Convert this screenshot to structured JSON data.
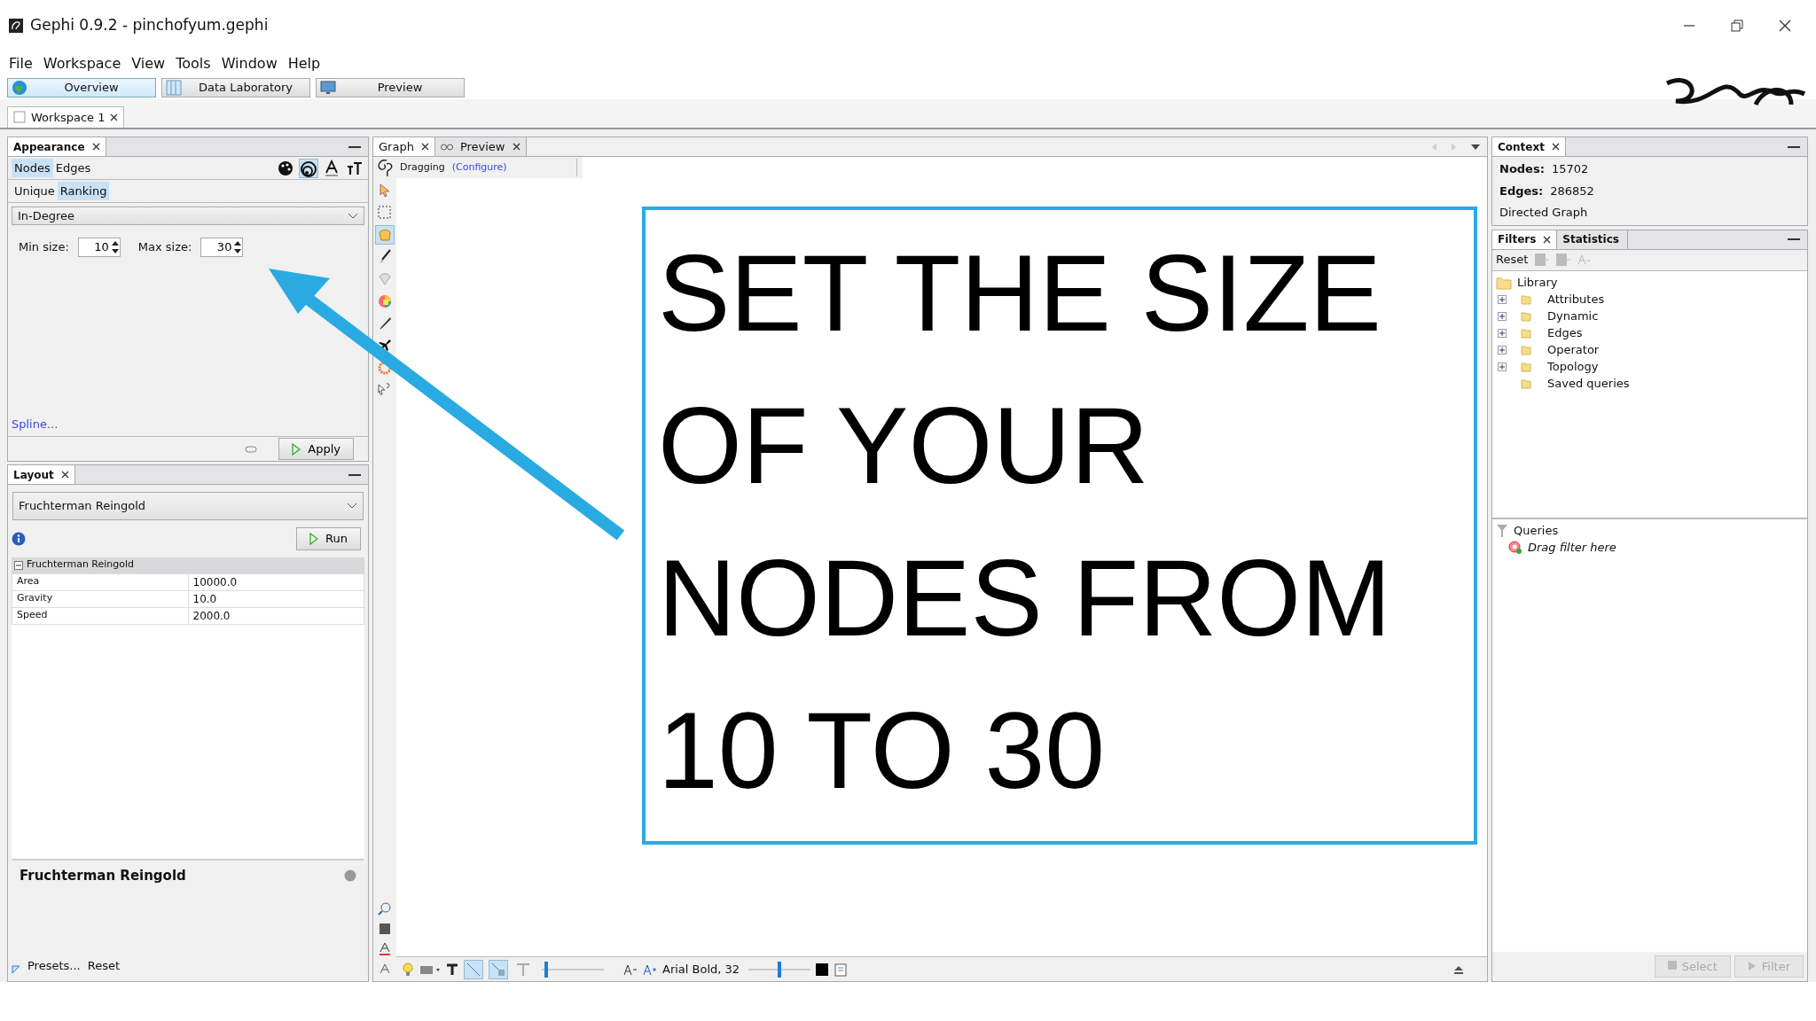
{
  "window": {
    "title": "Gephi 0.9.2 - pinchofyum.gephi"
  },
  "menu": [
    "File",
    "Workspace",
    "View",
    "Tools",
    "Window",
    "Help"
  ],
  "perspectives": [
    {
      "label": "Overview",
      "selected": true
    },
    {
      "label": "Data Laboratory",
      "selected": false
    },
    {
      "label": "Preview",
      "selected": false
    }
  ],
  "workspace_tabs": [
    {
      "label": "Workspace 1",
      "selected": true
    }
  ],
  "appearance": {
    "title": "Appearance",
    "element_tabs": [
      {
        "label": "Nodes",
        "selected": true
      },
      {
        "label": "Edges",
        "selected": false
      }
    ],
    "transform_icons": [
      {
        "kind": "color",
        "selected": false
      },
      {
        "kind": "size",
        "selected": true
      },
      {
        "kind": "label-color",
        "selected": false
      },
      {
        "kind": "label-size",
        "selected": false
      }
    ],
    "mode_tabs": [
      {
        "label": "Unique",
        "selected": false
      },
      {
        "label": "Ranking",
        "selected": true
      }
    ],
    "attribute": "In-Degree",
    "min_label": "Min size:",
    "min_value": "10",
    "max_label": "Max size:",
    "max_value": "30",
    "spline_link": "Spline...",
    "apply_button": "Apply"
  },
  "layout": {
    "title": "Layout",
    "algorithm": "Fruchterman Reingold",
    "run_button": "Run",
    "group": "Fruchterman Reingold",
    "properties": [
      {
        "name": "Area",
        "value": "10000.0"
      },
      {
        "name": "Gravity",
        "value": "10.0"
      },
      {
        "name": "Speed",
        "value": "2000.0"
      }
    ],
    "description_title": "Fruchterman Reingold",
    "presets": "Presets...",
    "reset": "Reset"
  },
  "graph": {
    "tabs": [
      {
        "label": "Graph",
        "selected": true
      },
      {
        "label": "Preview",
        "selected": false
      }
    ],
    "mode": "Dragging",
    "configure": "(Configure)",
    "tools": [
      {
        "kind": "pointer",
        "selected": false
      },
      {
        "kind": "rect",
        "selected": false
      },
      {
        "kind": "hand",
        "selected": true
      },
      {
        "kind": "brush",
        "selected": false
      },
      {
        "kind": "diamond",
        "selected": false
      },
      {
        "kind": "palette",
        "selected": false
      },
      {
        "kind": "pencil",
        "selected": false
      },
      {
        "kind": "plane",
        "selected": false
      },
      {
        "kind": "flower",
        "selected": false
      },
      {
        "kind": "help",
        "selected": false
      }
    ],
    "bottom_toggles": [
      {
        "kind": "edges",
        "selected": true
      },
      {
        "kind": "edge-color",
        "selected": true
      },
      {
        "kind": "label-text",
        "selected": false
      }
    ],
    "edge_scale": {
      "level": 0.05
    },
    "font": "Arial Bold, 32",
    "font_scale": {
      "level": 0.5
    },
    "caption": [
      "SET THE SIZE",
      "OF YOUR",
      "NODES FROM",
      "10 TO 30"
    ]
  },
  "context": {
    "title": "Context",
    "nodes_label": "Nodes:",
    "nodes": "15702",
    "edges_label": "Edges:",
    "edges": "286852",
    "graph_type": "Directed Graph"
  },
  "filters": {
    "tabs": [
      {
        "label": "Filters",
        "selected": true
      },
      {
        "label": "Statistics",
        "selected": false
      }
    ],
    "reset": "Reset",
    "library": "Library",
    "items": [
      {
        "label": "Attributes",
        "expandable": true
      },
      {
        "label": "Dynamic",
        "expandable": true
      },
      {
        "label": "Edges",
        "expandable": true
      },
      {
        "label": "Operator",
        "expandable": true
      },
      {
        "label": "Topology",
        "expandable": true
      },
      {
        "label": "Saved queries",
        "expandable": false
      }
    ],
    "queries": "Queries",
    "drag_hint": "Drag filter here",
    "buttons": [
      {
        "label": "Select",
        "disabled": true
      },
      {
        "label": "Filter",
        "disabled": true
      }
    ]
  }
}
